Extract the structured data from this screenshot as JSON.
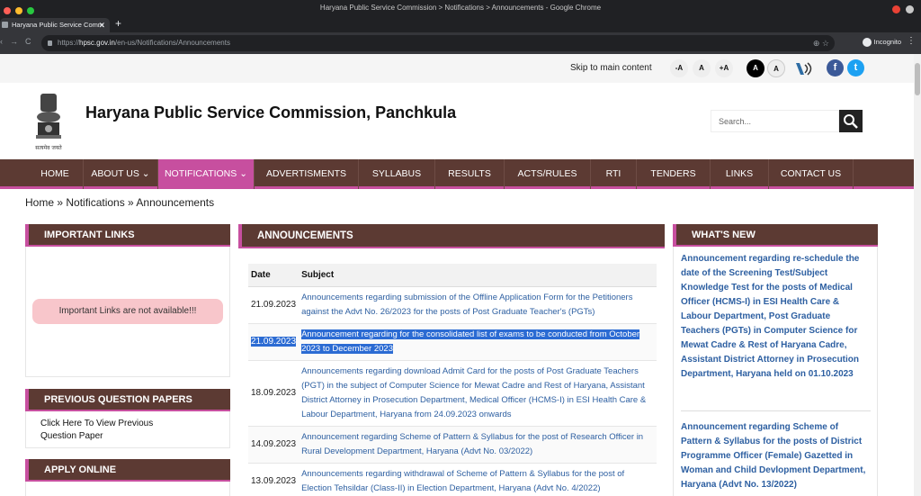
{
  "browser": {
    "window_title": "Haryana Public Service Commission > Notifications > Announcements - Google Chrome",
    "tab_title": "Haryana Public Service Comm",
    "url_scheme": "https://",
    "url_host": "hpsc.gov.in",
    "url_path": "/en-us/Notifications/Announcements",
    "incognito_label": "Incognito"
  },
  "topbar": {
    "skip_link": "Skip to main content",
    "font_decrease": "-A",
    "font_normal": "A",
    "font_increase": "+A",
    "contrast_dark": "A",
    "contrast_light": "A",
    "facebook": "f",
    "twitter": "t"
  },
  "header": {
    "emblem_caption": "सत्यमेव जयते",
    "site_title": "Haryana Public Service Commission, Panchkula",
    "search_placeholder": "Search..."
  },
  "nav": {
    "items": [
      {
        "label": "HOME"
      },
      {
        "label": "ABOUT US"
      },
      {
        "label": "NOTIFICATIONS"
      },
      {
        "label": "ADVERTISMENTS"
      },
      {
        "label": "SYLLABUS"
      },
      {
        "label": "RESULTS"
      },
      {
        "label": "ACTS/RULES"
      },
      {
        "label": "RTI"
      },
      {
        "label": "TENDERS"
      },
      {
        "label": "LINKS"
      },
      {
        "label": "CONTACT US"
      }
    ],
    "active": "NOTIFICATIONS"
  },
  "breadcrumb": {
    "text": "Home » Notifications » Announcements"
  },
  "left": {
    "important_links_title": "IMPORTANT LINKS",
    "important_links_empty": "Important Links are not available!!!",
    "prev_papers_title": "PREVIOUS QUESTION PAPERS",
    "prev_papers_line1": "Click Here To View Previous",
    "prev_papers_line2": "Question Paper",
    "apply_online_title": "APPLY ONLINE"
  },
  "announcements": {
    "title": "ANNOUNCEMENTS",
    "col_date": "Date",
    "col_subject": "Subject",
    "rows": [
      {
        "date": "21.09.2023",
        "subject": "Announcements regarding submission of the Offline Application Form for the Petitioners against the Advt No. 26/2023 for the posts of Post Graduate Teacher's (PGTs)"
      },
      {
        "date": "21.09.2023",
        "subject": "Announcement regarding for the consolidated list of exams to be conducted from October 2023 to December 2023"
      },
      {
        "date": "18.09.2023",
        "subject": "Announcements regarding download Admit Card for the posts of Post Graduate Teachers (PGT) in the subject of Computer Science for Mewat Cadre and Rest of Haryana, Assistant District Attorney in Prosecution Department, Medical Officer (HCMS-I) in ESI Health Care & Labour Department, Haryana from 24.09.2023 onwards"
      },
      {
        "date": "14.09.2023",
        "subject": "Announcement regarding Scheme of Pattern & Syllabus for the post of Research Officer in Rural Development Department, Haryana (Advt No. 03/2022)"
      },
      {
        "date": "13.09.2023",
        "subject": "Announcements regarding withdrawal of Scheme of Pattern & Syllabus for the post of Election Tehsildar (Class-II) in Election Department, Haryana (Advt No. 4/2022)"
      }
    ]
  },
  "whats_new": {
    "title": "WHAT'S NEW",
    "items": [
      {
        "text": "Announcement regarding re-schedule the date of the Screening Test/Subject Knowledge Test for the posts of Medical Officer (HCMS-I) in ESI Health Care & Labour Department, Post Graduate Teachers (PGTs) in Computer Science for Mewat Cadre & Rest of Haryana Cadre, Assistant District Attorney in Prosecution Department, Haryana held on 01.10.2023"
      },
      {
        "text": "Announcement regarding Scheme of Pattern & Syllabus for the posts of District Programme Officer (Female) Gazetted in Woman and Child Devlopment Department, Haryana (Advt No. 13/2022)"
      }
    ]
  },
  "colors": {
    "brown": "#5c3a33",
    "pink": "#c74f9f",
    "link": "#2d5fa1"
  }
}
